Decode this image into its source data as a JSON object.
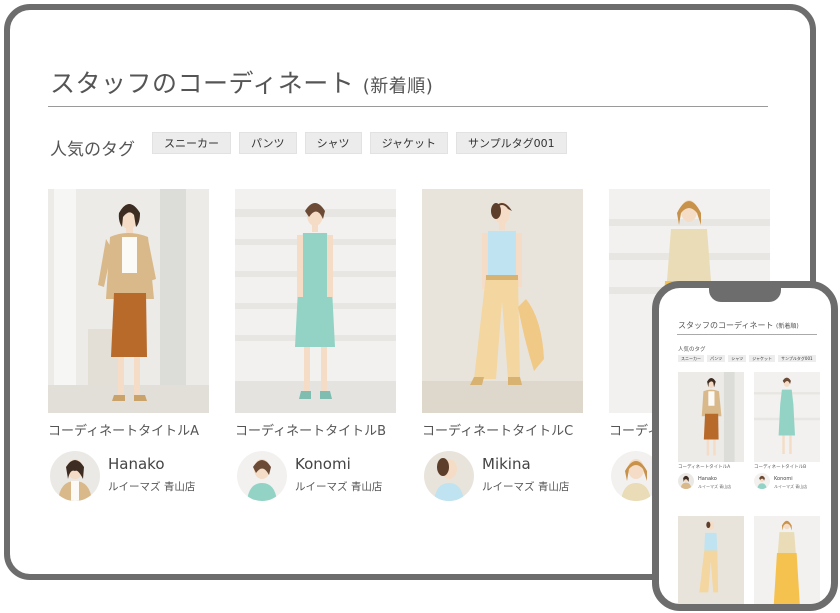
{
  "desktop": {
    "title": "スタッフのコーディネート",
    "title_suffix": "(新着順)",
    "tags_label": "人気のタグ",
    "tags": [
      "スニーカー",
      "パンツ",
      "シャツ",
      "ジャケット",
      "サンプルタグ001"
    ],
    "cards": [
      {
        "title": "コーディネートタイトルA",
        "staff": "Hanako",
        "shop": "ルイーマズ 青山店"
      },
      {
        "title": "コーディネートタイトルB",
        "staff": "Konomi",
        "shop": "ルイーマズ 青山店"
      },
      {
        "title": "コーディネートタイトルC",
        "staff": "Mikina",
        "shop": "ルイーマズ 青山店"
      },
      {
        "title": "コーディ",
        "staff": "",
        "shop": ""
      }
    ]
  },
  "phone": {
    "title": "スタッフのコーディネート",
    "title_suffix": "(新着順)",
    "tags_label": "人気のタグ",
    "tags": [
      "スニーカー",
      "パンツ",
      "シャツ",
      "ジャケット",
      "サンプルタグ001"
    ],
    "cards": [
      {
        "title": "コーディネートタイトルA",
        "staff": "Hanako",
        "shop": "ルイーマズ 青山店"
      },
      {
        "title": "コーディネートタイトルB",
        "staff": "Konomi",
        "shop": "ルイーマズ 青山店"
      }
    ]
  },
  "colors": {
    "frame": "#6d6d6d",
    "tag_bg": "#ececec",
    "rule": "#9a9a9a"
  }
}
